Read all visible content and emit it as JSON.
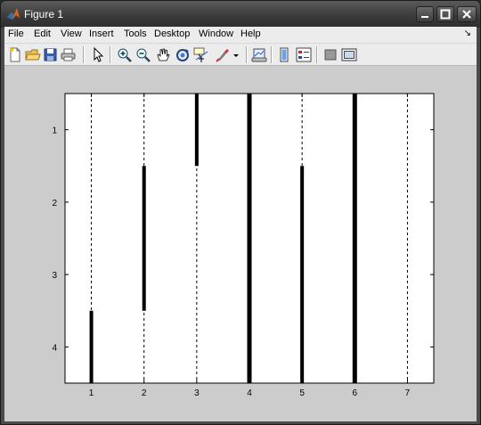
{
  "window": {
    "title": "Figure 1"
  },
  "menu": {
    "items": [
      "File",
      "Edit",
      "View",
      "Insert",
      "Tools",
      "Desktop",
      "Window",
      "Help"
    ]
  },
  "toolbar": {
    "tools": [
      "new-figure-icon",
      "open-file-icon",
      "save-icon",
      "print-icon",
      "pointer-icon",
      "zoom-in-icon",
      "zoom-out-icon",
      "pan-hand-icon",
      "rotate-3d-icon",
      "data-cursor-icon",
      "brush-icon",
      "brush-dropdown-icon",
      "link-plot-icon",
      "colorbar-icon",
      "legend-icon",
      "hide-plot-tools-icon",
      "show-plot-tools-icon"
    ]
  },
  "chart_data": {
    "type": "bar",
    "x_ticks": [
      1,
      2,
      3,
      4,
      5,
      6,
      7
    ],
    "y_ticks": [
      1,
      2,
      3,
      4
    ],
    "xlim": [
      0.5,
      7.5
    ],
    "ylim": [
      0.5,
      4.5
    ],
    "y_reversed": true,
    "grid": "vertical dashed lines at each x tick",
    "segments": [
      {
        "x": 1,
        "y_start": 3.5,
        "y_end": 4.5
      },
      {
        "x": 2,
        "y_start": 1.5,
        "y_end": 3.5
      },
      {
        "x": 3,
        "y_start": 0.5,
        "y_end": 1.5
      },
      {
        "x": 4,
        "y_start": 0.5,
        "y_end": 4.5
      },
      {
        "x": 5,
        "y_start": 1.5,
        "y_end": 4.5
      },
      {
        "x": 6,
        "y_start": 0.5,
        "y_end": 4.5
      }
    ]
  }
}
